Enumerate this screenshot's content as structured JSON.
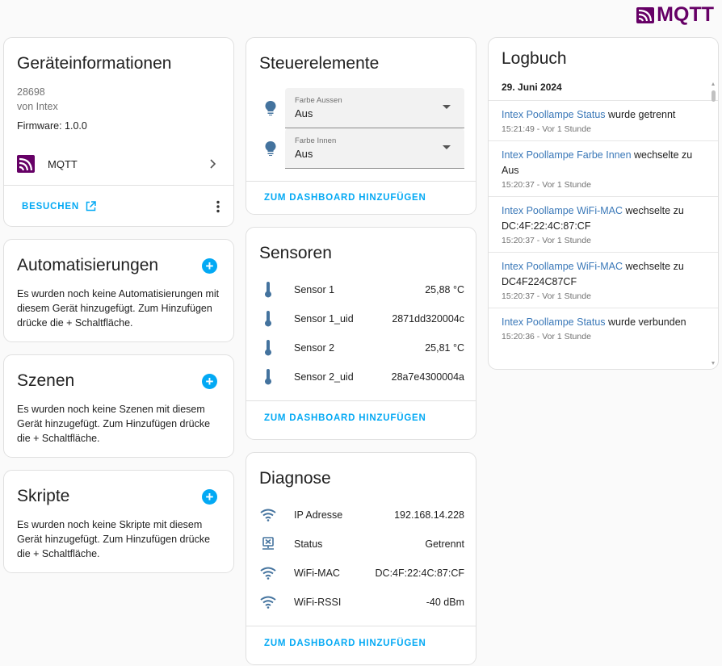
{
  "brand": {
    "logo_text": "MQTT",
    "color": "#660066"
  },
  "accent": "#03a9f4",
  "device_info": {
    "title": "Geräteinformationen",
    "model": "28698",
    "manufacturer": "von Intex",
    "firmware": "Firmware: 1.0.0",
    "integration_label": "MQTT",
    "visit_label": "BESUCHEN"
  },
  "automations": {
    "title": "Automatisierungen",
    "text": "Es wurden noch keine Automatisierungen mit diesem Gerät hinzugefügt. Zum Hinzufügen drücke die + Schaltfläche."
  },
  "scenes": {
    "title": "Szenen",
    "text": "Es wurden noch keine Szenen mit diesem Gerät hinzugefügt. Zum Hinzufügen drücke die + Schaltfläche."
  },
  "scripts": {
    "title": "Skripte",
    "text": "Es wurden noch keine Skripte mit diesem Gerät hinzugefügt. Zum Hinzufügen drücke die + Schaltfläche."
  },
  "controls": {
    "title": "Steuerelemente",
    "selects": [
      {
        "label": "Farbe Aussen",
        "value": "Aus",
        "icon": "lightbulb-icon"
      },
      {
        "label": "Farbe Innen",
        "value": "Aus",
        "icon": "lightbulb-icon"
      }
    ],
    "add_label": "ZUM DASHBOARD HINZUFÜGEN"
  },
  "sensors": {
    "title": "Sensoren",
    "items": [
      {
        "name": "Sensor 1",
        "value": "25,88 °C",
        "icon": "thermometer-icon"
      },
      {
        "name": "Sensor 1_uid",
        "value": "2871dd320004c",
        "icon": "thermometer-icon"
      },
      {
        "name": "Sensor 2",
        "value": "25,81 °C",
        "icon": "thermometer-icon"
      },
      {
        "name": "Sensor 2_uid",
        "value": "28a7e4300004a",
        "icon": "thermometer-icon"
      }
    ],
    "add_label": "ZUM DASHBOARD HINZUFÜGEN"
  },
  "diagnostics": {
    "title": "Diagnose",
    "items": [
      {
        "name": "IP Adresse",
        "value": "192.168.14.228",
        "icon": "wifi-icon"
      },
      {
        "name": "Status",
        "value": "Getrennt",
        "icon": "network-off-icon"
      },
      {
        "name": "WiFi-MAC",
        "value": "DC:4F:22:4C:87:CF",
        "icon": "wifi-icon"
      },
      {
        "name": "WiFi-RSSI",
        "value": "-40 dBm",
        "icon": "wifi-icon"
      }
    ],
    "add_label": "ZUM DASHBOARD HINZUFÜGEN"
  },
  "logbook": {
    "title": "Logbuch",
    "date": "29. Juni 2024",
    "entries": [
      {
        "entity": "Intex Poollampe Status",
        "message": " wurde getrennt",
        "time": "15:21:49 - Vor 1 Stunde"
      },
      {
        "entity": "Intex Poollampe Farbe Innen",
        "message": " wechselte zu Aus",
        "time": "15:20:37 - Vor 1 Stunde"
      },
      {
        "entity": "Intex Poollampe WiFi-MAC",
        "message": " wechselte zu DC:4F:22:4C:87:CF",
        "time": "15:20:37 - Vor 1 Stunde"
      },
      {
        "entity": "Intex Poollampe WiFi-MAC",
        "message": " wechselte zu DC4F224C87CF",
        "time": "15:20:37 - Vor 1 Stunde"
      },
      {
        "entity": "Intex Poollampe Status",
        "message": " wurde verbunden",
        "time": "15:20:36 - Vor 1 Stunde"
      }
    ]
  }
}
